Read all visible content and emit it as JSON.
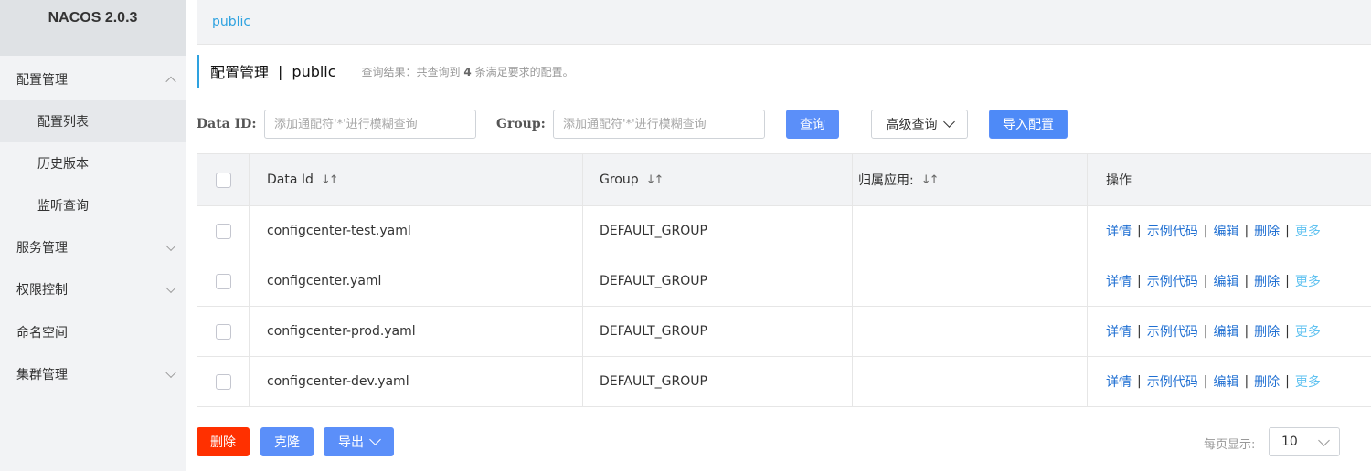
{
  "app": {
    "title": "NACOS 2.0.3"
  },
  "sidebar": {
    "items": [
      {
        "label": "配置管理",
        "chevron": "up"
      },
      {
        "label": "配置列表",
        "sub": true,
        "active": true
      },
      {
        "label": "历史版本",
        "sub": true
      },
      {
        "label": "监听查询",
        "sub": true
      },
      {
        "label": "服务管理",
        "chevron": "down"
      },
      {
        "label": "权限控制",
        "chevron": "down"
      },
      {
        "label": "命名空间"
      },
      {
        "label": "集群管理",
        "chevron": "down"
      }
    ]
  },
  "breadcrumb": {
    "namespace": "public"
  },
  "header": {
    "title": "配置管理",
    "separator": "|",
    "namespace": "public",
    "result_prefix": "查询结果：共查询到",
    "result_count": "4",
    "result_suffix": "条满足要求的配置。"
  },
  "search": {
    "data_id_label": "Data ID:",
    "data_id_placeholder": "添加通配符'*'进行模糊查询",
    "data_id_value": "",
    "group_label": "Group:",
    "group_placeholder": "添加通配符'*'进行模糊查询",
    "group_value": "",
    "query_button": "查询",
    "advanced_button": "高级查询",
    "import_button": "导入配置"
  },
  "table": {
    "headers": {
      "data_id": "Data Id",
      "group": "Group",
      "app": "归属应用:",
      "actions": "操作"
    },
    "action_labels": {
      "detail": "详情",
      "sample": "示例代码",
      "edit": "编辑",
      "delete": "删除",
      "more": "更多",
      "sep": "|"
    },
    "rows": [
      {
        "data_id": "configcenter-test.yaml",
        "group": "DEFAULT_GROUP",
        "app": ""
      },
      {
        "data_id": "configcenter.yaml",
        "group": "DEFAULT_GROUP",
        "app": ""
      },
      {
        "data_id": "configcenter-prod.yaml",
        "group": "DEFAULT_GROUP",
        "app": ""
      },
      {
        "data_id": "configcenter-dev.yaml",
        "group": "DEFAULT_GROUP",
        "app": ""
      }
    ]
  },
  "footer": {
    "delete_button": "删除",
    "clone_button": "克隆",
    "export_button": "导出",
    "page_size_label": "每页显示:",
    "page_size_value": "10"
  },
  "colors": {
    "accent": "#2ea2e0",
    "primary_button": "#5b8ff9",
    "danger_button": "#ff3000",
    "link": "#1f6fd2",
    "link_more": "#5ec1f0"
  }
}
